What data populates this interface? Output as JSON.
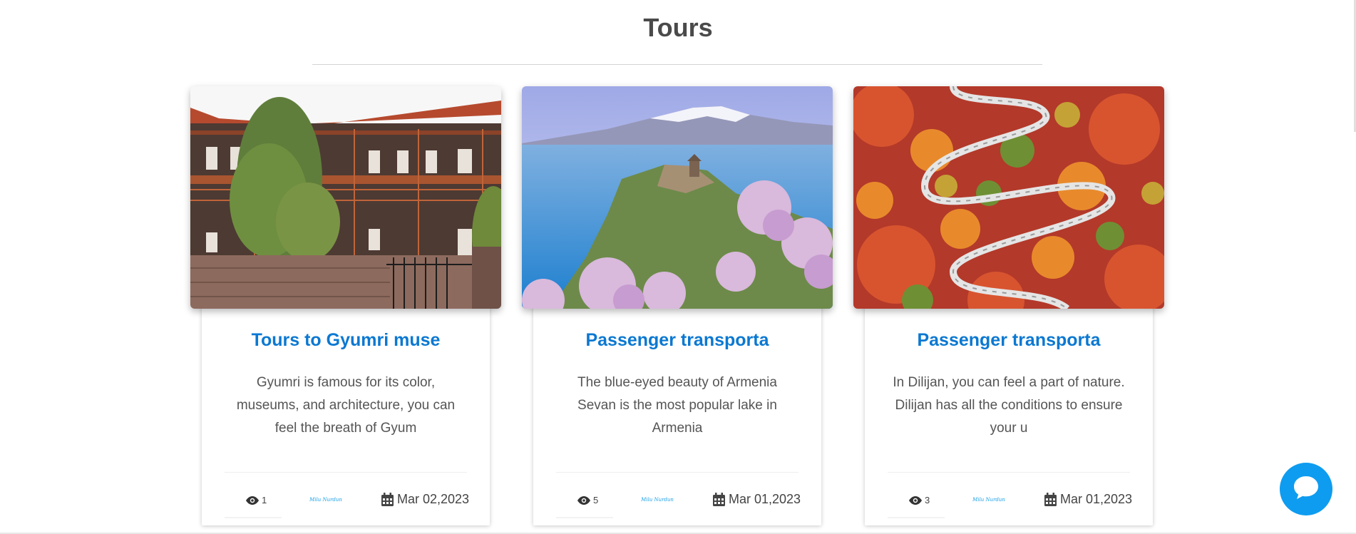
{
  "section": {
    "title": "Tours"
  },
  "cards": [
    {
      "title": "Tours to Gyumri muse",
      "description": "Gyumri is famous for its color, museums, and architecture, you can feel the breath of Gyum",
      "views": "1",
      "author": "Milu Nurdun",
      "date": "Mar 02,2023",
      "image": "Gyumri building with wooden balconies"
    },
    {
      "title": "Passenger transporta",
      "description": "The blue-eyed beauty of Armenia Sevan is the most popular lake in Armenia",
      "views": "5",
      "author": "Milu Nurdun",
      "date": "Mar 01,2023",
      "image": "Lake with snowy mountains and blossoming trees"
    },
    {
      "title": "Passenger transporta",
      "description": "In Dilijan, you can feel a part of nature. Dilijan has all the conditions to ensure your u",
      "views": "3",
      "author": "Milu Nurdun",
      "date": "Mar 01,2023",
      "image": "Winding road through autumn forest"
    }
  ],
  "icons": {
    "views": "eye-icon",
    "date": "calendar-icon",
    "chat": "chat-bubble-icon"
  },
  "colors": {
    "accent": "#0b78d1",
    "chat": "#0e9cf0",
    "text": "#555555"
  }
}
